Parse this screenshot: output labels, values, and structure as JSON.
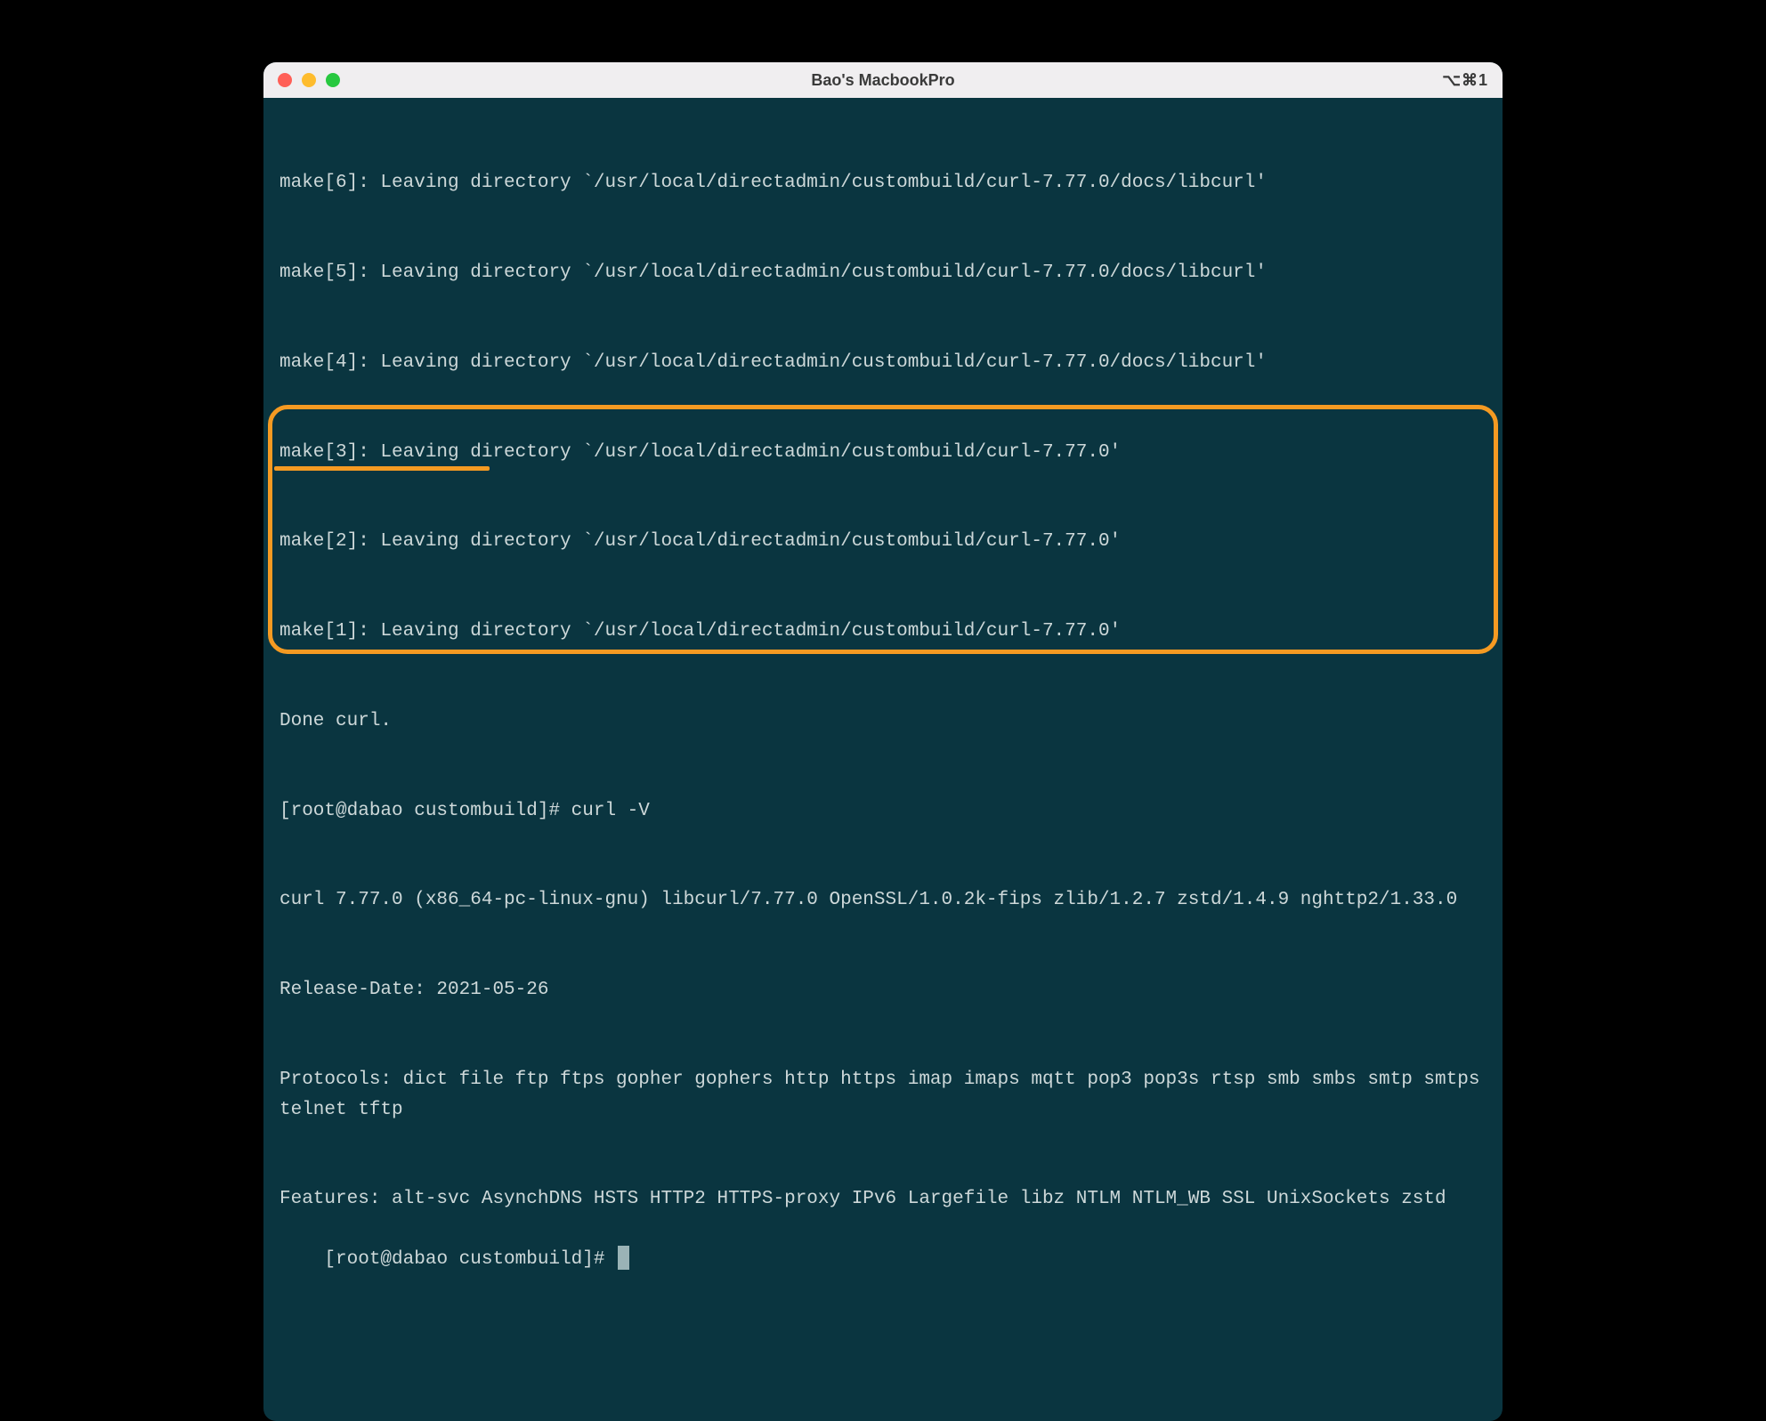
{
  "window": {
    "title": "Bao's MacbookPro",
    "shortcut": "⌥⌘1"
  },
  "terminal": {
    "lines": {
      "l0": "make[6]: Leaving directory `/usr/local/directadmin/custombuild/curl-7.77.0/docs/libcurl'",
      "l1": "make[5]: Leaving directory `/usr/local/directadmin/custombuild/curl-7.77.0/docs/libcurl'",
      "l2": "make[4]: Leaving directory `/usr/local/directadmin/custombuild/curl-7.77.0/docs/libcurl'",
      "l3": "make[3]: Leaving directory `/usr/local/directadmin/custombuild/curl-7.77.0'",
      "l4": "make[2]: Leaving directory `/usr/local/directadmin/custombuild/curl-7.77.0'",
      "l5": "make[1]: Leaving directory `/usr/local/directadmin/custombuild/curl-7.77.0'",
      "l6": "Done curl.",
      "l7": "[root@dabao custombuild]# curl -V",
      "l8": "curl 7.77.0 (x86_64-pc-linux-gnu) libcurl/7.77.0 OpenSSL/1.0.2k-fips zlib/1.2.7 zstd/1.4.9 nghttp2/1.33.0",
      "l9": "Release-Date: 2021-05-26",
      "l10": "Protocols: dict file ftp ftps gopher gophers http https imap imaps mqtt pop3 pop3s rtsp smb smbs smtp smtps telnet tftp",
      "l11": "Features: alt-svc AsynchDNS HSTS HTTP2 HTTPS-proxy IPv6 Largefile libz NTLM NTLM_WB SSL UnixSockets zstd",
      "prompt": "[root@dabao custombuild]# "
    }
  }
}
